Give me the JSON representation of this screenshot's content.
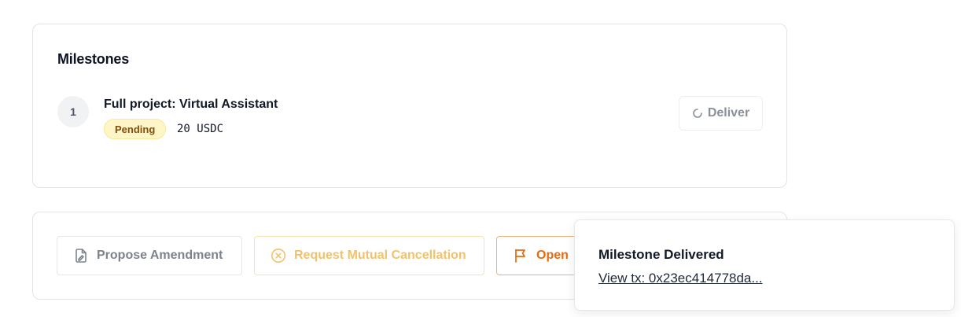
{
  "milestones": {
    "title": "Milestones",
    "items": [
      {
        "number": "1",
        "name": "Full project: Virtual Assistant",
        "status": "Pending",
        "amount": "20 USDC",
        "action_label": "Deliver"
      }
    ]
  },
  "actions": {
    "propose_amendment": "Propose Amendment",
    "request_cancellation": "Request Mutual Cancellation",
    "open_dispute": "Open"
  },
  "toast": {
    "title": "Milestone Delivered",
    "link": "View tx: 0x23ec414778da..."
  },
  "icons": {
    "deliver": "loading-spinner-icon",
    "amendment": "file-signature-icon",
    "cancellation": "x-circle-icon",
    "dispute": "flag-icon"
  },
  "colors": {
    "pending_badge_bg": "#fef6c7",
    "pending_badge_text": "#854d0e",
    "cancel_accent": "#f2c26b",
    "dispute_accent": "#ea6a0c"
  }
}
